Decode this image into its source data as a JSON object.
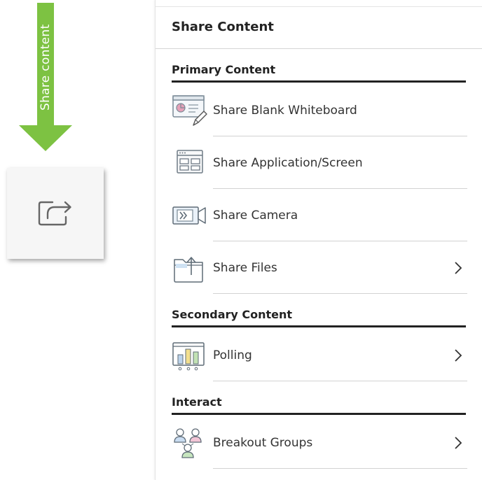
{
  "callout": {
    "label": "Share content",
    "arrow_color": "#7dc242"
  },
  "share_button": {
    "icon": "share-arrow-icon"
  },
  "panel": {
    "title": "Share Content",
    "sections": {
      "primary": {
        "title": "Primary Content",
        "items": [
          {
            "label": "Share Blank Whiteboard",
            "icon": "whiteboard-icon",
            "has_submenu": false
          },
          {
            "label": "Share Application/Screen",
            "icon": "application-screen-icon",
            "has_submenu": false
          },
          {
            "label": "Share Camera",
            "icon": "camera-icon",
            "has_submenu": false
          },
          {
            "label": "Share Files",
            "icon": "share-files-icon",
            "has_submenu": true
          }
        ]
      },
      "secondary": {
        "title": "Secondary Content",
        "items": [
          {
            "label": "Polling",
            "icon": "polling-icon",
            "has_submenu": true
          }
        ]
      },
      "interact": {
        "title": "Interact",
        "items": [
          {
            "label": "Breakout Groups",
            "icon": "breakout-groups-icon",
            "has_submenu": true
          }
        ]
      }
    }
  }
}
